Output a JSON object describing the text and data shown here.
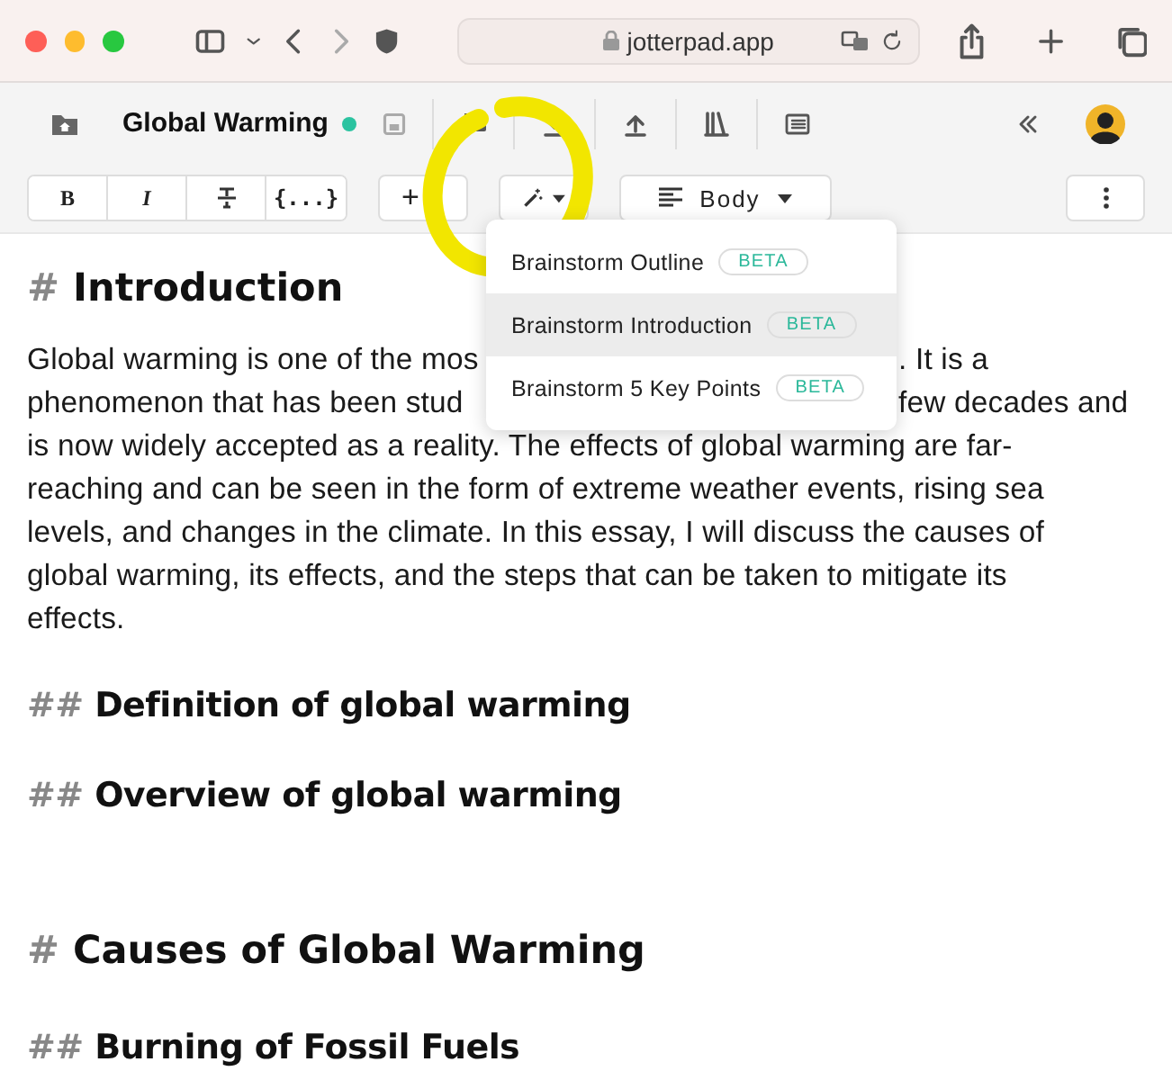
{
  "browser": {
    "url": "jotterpad.app"
  },
  "toolbar": {
    "title": "Global Warming",
    "synced": true
  },
  "format_buttons": [
    {
      "kind": "bold",
      "label": "B"
    },
    {
      "kind": "italic",
      "label": "I"
    },
    {
      "kind": "strike"
    },
    {
      "kind": "code",
      "label": "{...}"
    }
  ],
  "insert_button": {
    "label": "+"
  },
  "style_dropdown": {
    "label": "Body"
  },
  "menu": {
    "items": [
      {
        "label": "Brainstorm Outline",
        "badge": "BETA",
        "selected": false
      },
      {
        "label": "Brainstorm Introduction",
        "badge": "BETA",
        "selected": true
      },
      {
        "label": "Brainstorm 5 Key Points",
        "badge": "BETA",
        "selected": false
      }
    ]
  },
  "document": [
    {
      "kind": "heading1",
      "marker": "#",
      "text": "Introduction"
    },
    {
      "kind": "paragraph",
      "lines": [
        {
          "left": "Global warming is one of the mos",
          "right": ". It is a"
        },
        {
          "left": "phenomenon that has been stud",
          "right": "few decades and"
        },
        {
          "left": "is now widely accepted as a reality. The effects of global warming are far-"
        },
        {
          "left": "reaching and can be seen in the form of extreme weather events, rising sea"
        },
        {
          "left": "levels, and changes in the climate. In this essay, I will discuss the causes of"
        },
        {
          "left": "global warming, its effects, and the steps that can be taken to mitigate its"
        },
        {
          "left": "effects."
        }
      ]
    },
    {
      "kind": "heading2",
      "marker": "##",
      "text": "Definition of global warming"
    },
    {
      "kind": "heading2",
      "marker": "##",
      "text": "Overview of global warming"
    },
    {
      "kind": "blank"
    },
    {
      "kind": "heading1",
      "marker": "#",
      "text": "Causes of Global Warming"
    },
    {
      "kind": "heading2",
      "marker": "##",
      "text": "Burning of Fossil Fuels"
    }
  ]
}
